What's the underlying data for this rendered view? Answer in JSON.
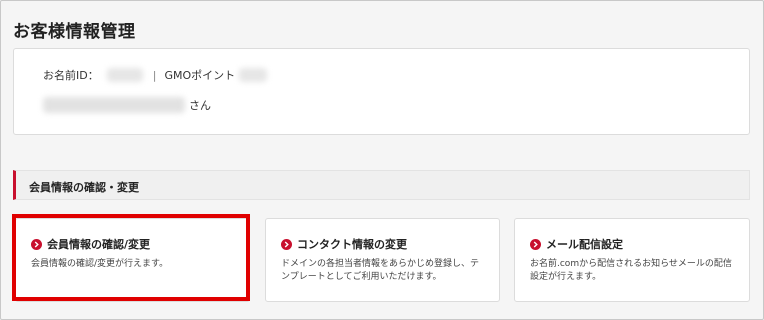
{
  "page": {
    "title": "お客様情報管理"
  },
  "customer": {
    "id_label": "お名前ID：",
    "separator": "|",
    "gmo_label": "GMOポイント",
    "name_suffix": "さん"
  },
  "section": {
    "title": "会員情報の確認・変更"
  },
  "cards": [
    {
      "title": "会員情報の確認/変更",
      "description": "会員情報の確認/変更が行えます。",
      "icon": "circle-arrow-right-icon",
      "highlighted": true
    },
    {
      "title": "コンタクト情報の変更",
      "description": "ドメインの各担当者情報をあらかじめ登録し、テンプレートとしてご利用いただけます。",
      "icon": "circle-arrow-right-icon",
      "highlighted": false
    },
    {
      "title": "メール配信設定",
      "description": "お名前.comから配信されるお知らせメールの配信設定が行えます。",
      "icon": "circle-arrow-right-icon",
      "highlighted": false
    }
  ],
  "colors": {
    "accent": "#c8102e",
    "highlight": "#e00000"
  }
}
